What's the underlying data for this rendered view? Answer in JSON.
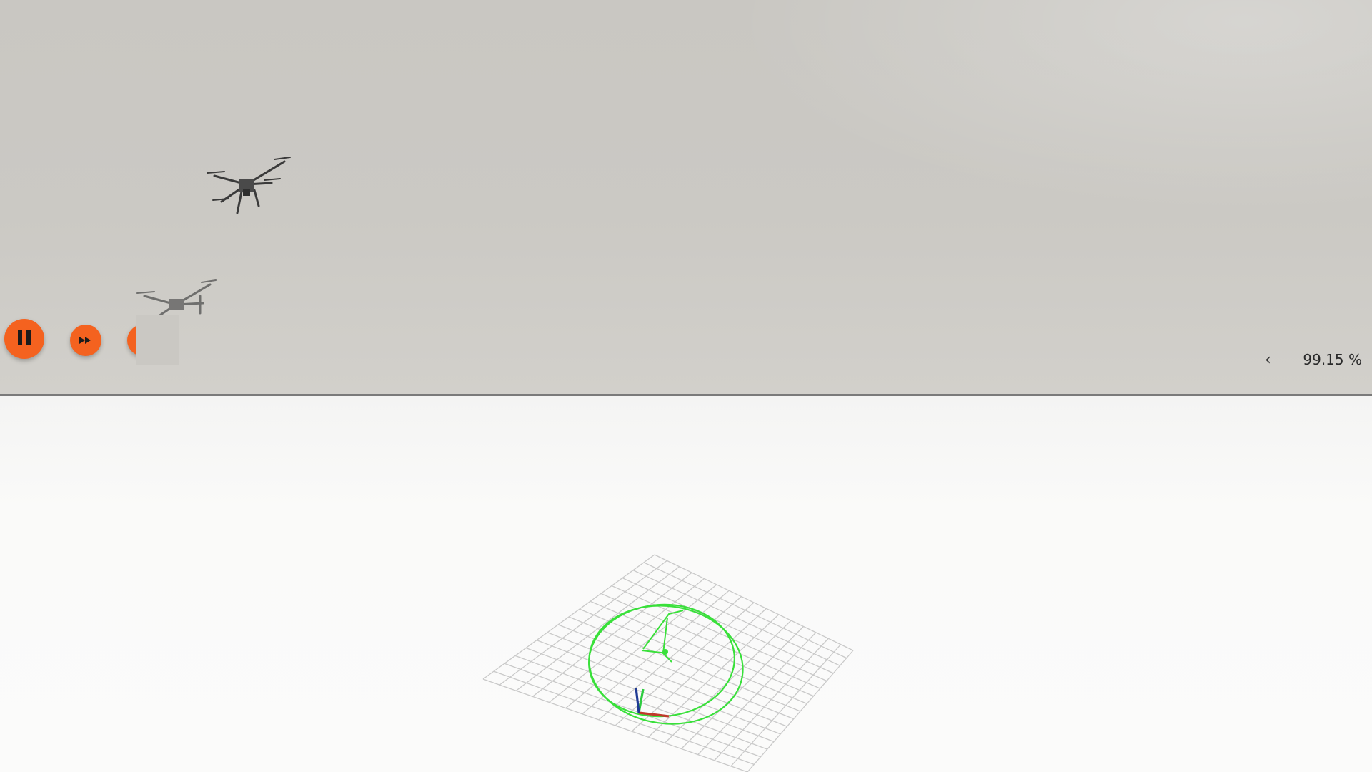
{
  "player": {
    "pause_label": "pause",
    "fast_forward_label": "fast-forward",
    "progress_text": "99.15 %",
    "collapse_glyph": "‹"
  },
  "colors": {
    "accent": "#f4621f",
    "trajectory": "#39e03a",
    "grid": "#c9c9c9",
    "axis_x": "#c0392b",
    "axis_y": "#2ecc40",
    "axis_z": "#1f3a93"
  },
  "icons": {
    "pause": "pause-icon",
    "fast_forward": "fast-forward-icon",
    "next": "next-icon",
    "collapse": "chevron-left-icon"
  }
}
